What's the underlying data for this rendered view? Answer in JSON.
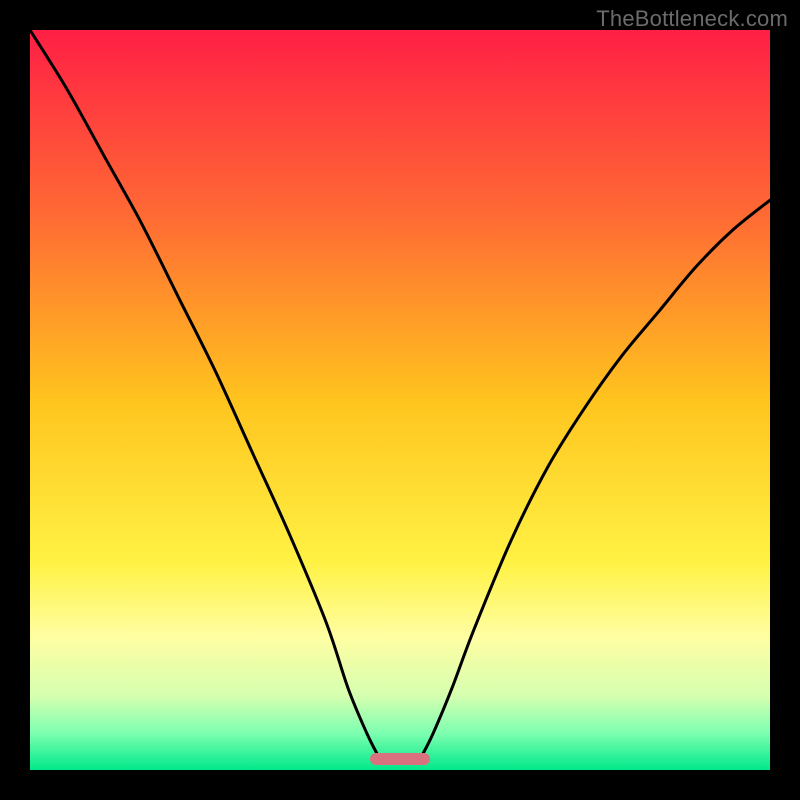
{
  "watermark": "TheBottleneck.com",
  "chart_data": {
    "type": "line",
    "title": "",
    "xlabel": "",
    "ylabel": "",
    "xlim": [
      0,
      1
    ],
    "ylim": [
      0,
      1
    ],
    "grid": false,
    "legend": false,
    "background_gradient": {
      "stops": [
        {
          "pos": 0.0,
          "color": "#ff1f45"
        },
        {
          "pos": 0.25,
          "color": "#ff6a34"
        },
        {
          "pos": 0.5,
          "color": "#ffc41e"
        },
        {
          "pos": 0.72,
          "color": "#fff244"
        },
        {
          "pos": 0.82,
          "color": "#fffea2"
        },
        {
          "pos": 0.9,
          "color": "#d6ffb0"
        },
        {
          "pos": 0.95,
          "color": "#7dffb0"
        },
        {
          "pos": 1.0,
          "color": "#00e88a"
        }
      ]
    },
    "series": [
      {
        "name": "left-curve",
        "x": [
          0.0,
          0.05,
          0.1,
          0.15,
          0.2,
          0.25,
          0.3,
          0.35,
          0.4,
          0.43,
          0.455,
          0.47
        ],
        "y": [
          1.0,
          0.92,
          0.83,
          0.74,
          0.64,
          0.54,
          0.43,
          0.32,
          0.2,
          0.11,
          0.05,
          0.02
        ]
      },
      {
        "name": "right-curve",
        "x": [
          0.53,
          0.545,
          0.57,
          0.6,
          0.65,
          0.7,
          0.75,
          0.8,
          0.85,
          0.9,
          0.95,
          1.0
        ],
        "y": [
          0.02,
          0.05,
          0.11,
          0.19,
          0.31,
          0.41,
          0.49,
          0.56,
          0.62,
          0.68,
          0.73,
          0.77
        ]
      }
    ],
    "marker": {
      "name": "bottleneck-marker",
      "x_center": 0.5,
      "width_frac": 0.08,
      "y": 0.015,
      "color": "#d9717e"
    }
  }
}
